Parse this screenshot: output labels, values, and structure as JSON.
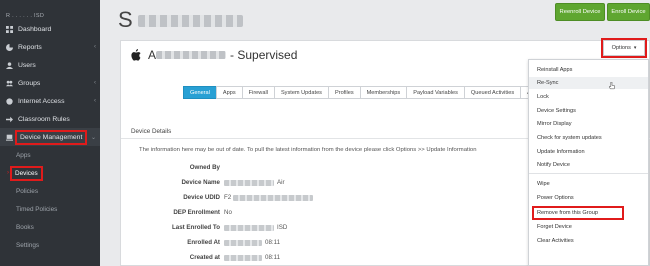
{
  "sidebar": {
    "org_name": "R . .  .  .  .  . ISD",
    "items": [
      {
        "label": "Dashboard",
        "icon": "dashboard-icon"
      },
      {
        "label": "Reports",
        "icon": "pie-chart-icon",
        "chevron": "‹"
      },
      {
        "label": "Users",
        "icon": "user-icon"
      },
      {
        "label": "Groups",
        "icon": "users-icon",
        "chevron": "‹"
      },
      {
        "label": "Internet Access",
        "icon": "globe-icon",
        "chevron": "‹"
      },
      {
        "label": "Classroom Rules",
        "icon": "arrow-icon"
      },
      {
        "label": "Device Management",
        "icon": "laptop-icon",
        "chevron": "⌄"
      }
    ],
    "sub_items": [
      "Apps",
      "Devices",
      "Policies",
      "Timed Policies",
      "Books",
      "Settings"
    ]
  },
  "header": {
    "title": "S",
    "reenroll_label": "Reenroll Device",
    "enroll_label": "Enroll Device"
  },
  "device": {
    "name_prefix": "A",
    "name_suffix": "- Supervised"
  },
  "tabs": [
    "General",
    "Apps",
    "Firewall",
    "System Updates",
    "Profiles",
    "Memberships",
    "Payload Variables",
    "Queued Activities",
    "Activity E"
  ],
  "details": {
    "section_title": "Device Details",
    "notice": "The information here may be out of date. To pull the latest information from the device please click Options >> Update Information",
    "fields": [
      {
        "label": "Owned By",
        "value": ""
      },
      {
        "label": "Device Name",
        "value": "Air"
      },
      {
        "label": "Device UDID",
        "value": "F2"
      },
      {
        "label": "DEP Enrollment",
        "value": "No"
      },
      {
        "label": "Last Enrolled To",
        "value": "ISD"
      },
      {
        "label": "Enrolled At",
        "value": "08:11"
      },
      {
        "label": "Created at",
        "value": "08:11"
      }
    ]
  },
  "options": {
    "label": "Options",
    "menu_group1": [
      "Reinstall Apps",
      "Re-Sync",
      "Lock",
      "Device Settings",
      "Mirror Display",
      "Check for system updates",
      "Update Information",
      "Notify Device"
    ],
    "menu_group2": [
      "Wipe",
      "Power Options",
      "Remove from this Group",
      "Forget Device",
      "Clear Activities"
    ]
  },
  "colors": {
    "sidebar_bg": "#2f3338",
    "tab_active": "#28a0d4",
    "button_green": "#5fa630",
    "highlight_red": "#e01b1b"
  }
}
